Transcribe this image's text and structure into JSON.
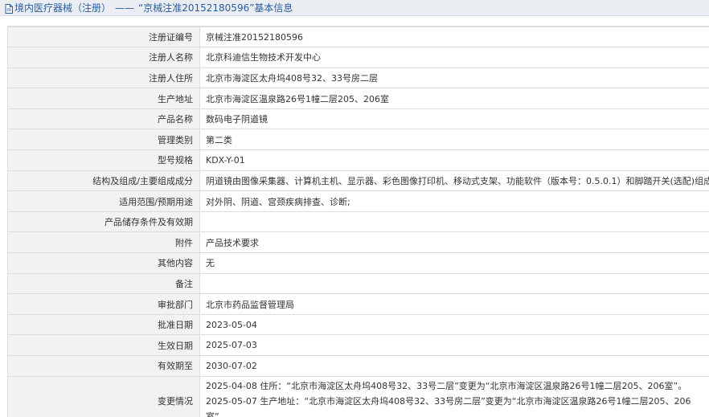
{
  "header": {
    "section": "境内医疗器械（注册）",
    "separator": "——",
    "record": "“京械注准20152180596”基本信息"
  },
  "rows": [
    {
      "label": "注册证编号",
      "value": "京械注准20152180596"
    },
    {
      "label": "注册人名称",
      "value": "北京科迪信生物技术开发中心"
    },
    {
      "label": "注册人住所",
      "value": "北京市海淀区太舟坞408号32、33号房二层"
    },
    {
      "label": "生产地址",
      "value": "北京市海淀区温泉路26号1幢二层205、206室"
    },
    {
      "label": "产品名称",
      "value": "数码电子阴道镜"
    },
    {
      "label": "管理类别",
      "value": "第二类"
    },
    {
      "label": "型号规格",
      "value": "KDX-Y-01"
    },
    {
      "label": "结构及组成/主要组成成分",
      "value": "阴道镜由图像采集器、计算机主机、显示器、彩色图像打印机、移动式支架、功能软件（版本号：0.5.0.1）和脚踏开关(选配)组成。"
    },
    {
      "label": "适用范围/预期用途",
      "value": "对外阴、阴道、宫颈疾病排查、诊断;"
    },
    {
      "label": "产品储存条件及有效期",
      "value": ""
    },
    {
      "label": "附件",
      "value": "产品技术要求"
    },
    {
      "label": "其他内容",
      "value": "无"
    },
    {
      "label": "备注",
      "value": ""
    },
    {
      "label": "审批部门",
      "value": "北京市药品监督管理局"
    },
    {
      "label": "批准日期",
      "value": "2023-05-04"
    },
    {
      "label": "生效日期",
      "value": "2025-07-03"
    },
    {
      "label": "有效期至",
      "value": "2030-07-02"
    },
    {
      "label": "变更情况",
      "value": "2025-04-08 住所：“北京市海淀区太舟坞408号32、33号二层”变更为“北京市海淀区温泉路26号1幢二层205、206室”。2025-05-07 生产地址：“北京市海淀区太舟坞408号32、33号房二层”变更为“北京市海淀区温泉路26号1幢二层205、206室”。"
    }
  ]
}
